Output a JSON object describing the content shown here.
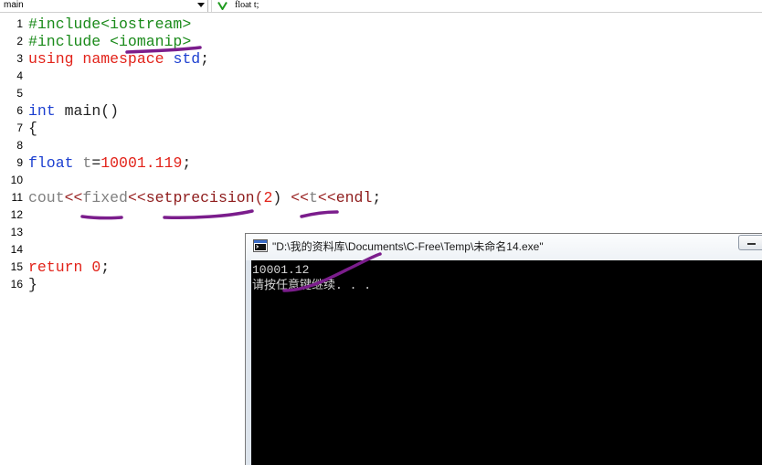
{
  "toolbar": {
    "scope_value": "main",
    "scope_dropdown_icon": "chevron-down-icon",
    "member_icon": "variable-icon",
    "member_value": "float t;"
  },
  "editor": {
    "syntax_colors": {
      "preprocessor": "#1a8a1a",
      "keyword": "#e2231a",
      "type": "#1c3fd0",
      "number": "#e2231a",
      "identifier": "#808080",
      "function": "#8e1b1b",
      "operator": "#9a2424",
      "plain": "#222222"
    },
    "lines": [
      {
        "number": "1",
        "tokens": [
          {
            "text": "#include<iostream>",
            "type": "preprocessor"
          }
        ]
      },
      {
        "number": "2",
        "tokens": [
          {
            "text": "#include <iomanip>",
            "type": "preprocessor"
          }
        ]
      },
      {
        "number": "3",
        "tokens": [
          {
            "text": "using ",
            "type": "keyword"
          },
          {
            "text": "namespace ",
            "type": "keyword"
          },
          {
            "text": "std",
            "type": "type"
          },
          {
            "text": ";",
            "type": "plain"
          }
        ]
      },
      {
        "number": "4",
        "tokens": []
      },
      {
        "number": "5",
        "tokens": []
      },
      {
        "number": "6",
        "tokens": [
          {
            "text": "int",
            "type": "type"
          },
          {
            "text": " main()",
            "type": "plain"
          }
        ]
      },
      {
        "number": "7",
        "tokens": [
          {
            "text": "{",
            "type": "plain"
          }
        ]
      },
      {
        "number": "8",
        "tokens": []
      },
      {
        "number": "9",
        "tokens": [
          {
            "text": "float ",
            "type": "type"
          },
          {
            "text": "t",
            "type": "identifier"
          },
          {
            "text": "=",
            "type": "plain"
          },
          {
            "text": "10001.119",
            "type": "number"
          },
          {
            "text": ";",
            "type": "plain"
          }
        ]
      },
      {
        "number": "10",
        "tokens": []
      },
      {
        "number": "11",
        "tokens": [
          {
            "text": "cout",
            "type": "identifier"
          },
          {
            "text": "<<",
            "type": "operator"
          },
          {
            "text": "fixed",
            "type": "identifier"
          },
          {
            "text": "<<",
            "type": "operator"
          },
          {
            "text": "setprecision",
            "type": "function"
          },
          {
            "text": "(",
            "type": "operator"
          },
          {
            "text": "2",
            "type": "number"
          },
          {
            "text": ") ",
            "type": "plain"
          },
          {
            "text": "<<",
            "type": "operator"
          },
          {
            "text": "t",
            "type": "identifier"
          },
          {
            "text": "<<",
            "type": "operator"
          },
          {
            "text": "endl",
            "type": "function"
          },
          {
            "text": ";",
            "type": "plain"
          }
        ]
      },
      {
        "number": "12",
        "tokens": []
      },
      {
        "number": "13",
        "tokens": []
      },
      {
        "number": "14",
        "tokens": []
      },
      {
        "number": "15",
        "tokens": [
          {
            "text": "return ",
            "type": "keyword"
          },
          {
            "text": "0",
            "type": "number"
          },
          {
            "text": ";",
            "type": "plain"
          }
        ]
      },
      {
        "number": "16",
        "tokens": [
          {
            "text": "}",
            "type": "plain"
          }
        ]
      }
    ]
  },
  "console": {
    "app_icon": "console-app-icon",
    "title": "\"D:\\我的资料库\\Documents\\C-Free\\Temp\\未命名14.exe\"",
    "minimize_icon": "minimize-icon",
    "output": [
      "10001.12",
      "请按任意键继续. . ."
    ]
  },
  "annotations": {
    "stroke_color": "#7b1d8c"
  }
}
